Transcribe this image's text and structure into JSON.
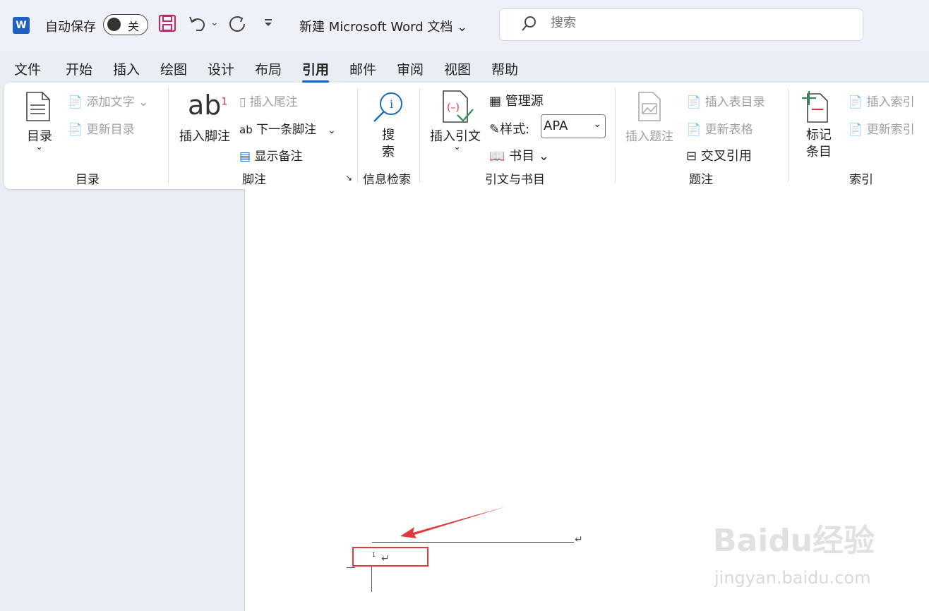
{
  "titlebar": {
    "app_icon": "W",
    "autosave_label": "自动保存",
    "autosave_state": "关",
    "doc_title": "新建 Microsoft Word 文档",
    "search_placeholder": "搜索"
  },
  "menu": [
    "文件",
    "开始",
    "插入",
    "绘图",
    "设计",
    "布局",
    "引用",
    "邮件",
    "审阅",
    "视图",
    "帮助"
  ],
  "active_menu": "引用",
  "ribbon": {
    "toc": {
      "button": "目录",
      "add_text": "添加文字",
      "update_toc": "更新目录",
      "group": "目录"
    },
    "footnotes": {
      "insert_footnote": "插入脚注",
      "insert_endnote": "插入尾注",
      "next_footnote": "下一条脚注",
      "show_notes": "显示备注",
      "group": "脚注"
    },
    "research": {
      "search_line1": "搜",
      "search_line2": "索",
      "group": "信息检索"
    },
    "citations": {
      "insert_citation": "插入引文",
      "manage_sources": "管理源",
      "style_label": "样式:",
      "style_value": "APA",
      "bibliography": "书目",
      "group": "引文与书目"
    },
    "captions": {
      "insert_caption": "插入题注",
      "insert_table_of_figures": "插入表目录",
      "update_table": "更新表格",
      "cross_reference": "交叉引用",
      "group": "题注"
    },
    "index": {
      "mark_entry_line1": "标记",
      "mark_entry_line2": "条目",
      "insert_index": "插入索引",
      "update_index": "更新索引",
      "group": "索引"
    }
  },
  "document": {
    "footnote_number": "1",
    "paragraph_mark": "↵"
  },
  "watermark": {
    "brand": "Baidu经验",
    "url": "jingyan.baidu.com"
  },
  "colors": {
    "accent": "#1a5ec0",
    "highlight_box": "#e03a3a",
    "arrow": "#e03a3a"
  }
}
